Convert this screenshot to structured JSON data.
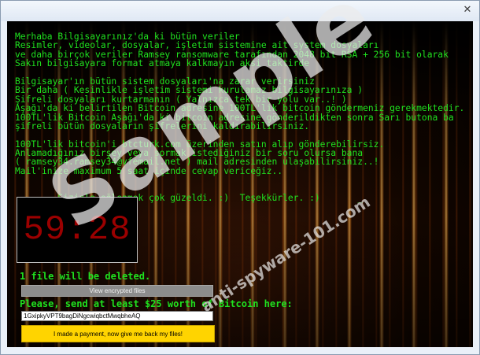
{
  "window": {
    "close_glyph": "✕"
  },
  "message_lines": [
    "Merhaba Bilgisayarınız'da ki bütün veriler",
    "Resimler, videolar, dosyalar, işletim sistemine ait system dosyaları",
    "ve daha birçok veriler Ramsey ransomware tarafından 2048 bit RSA + 256 bit olarak",
    "Sakın bilgisayara format atmaya kalkmayın aksi taktirde",
    "",
    "Bilgisayar'ın bütün sistem dosyaları'na zarar verirsiniz",
    "Bir daha ( Kesinlikle işletim sistemi kurulamaz bilgisayarınıza )",
    "Şifreli dosyaları kurtarmanın ( Yalnızca tek bir yolu var..! )",
    "Aşağı'da ki belirtilen Bitcoin adresine 100TL'lik bitcoin göndermeniz gerekmektedir.",
    "100TL'lik Bitcoin Aşağı'da ki bitcoin adresine gönderildikten sonra Sarı butona ba",
    "şifreli bütün dosyaların şifrelerini kaldırabilirsiniz.",
    "",
    "100TL'lik bitcoin'i btcturk.com üzerinden satın alıp gönderebilirsiz.",
    "Anlamadığınız birşey veya sormak istediğiniz bir soru olursa bana",
    "( ramsey34.ramsey34@vfemail.net ) mail adresinden ulaşabilirsiniz..!",
    "Mail'inize maximum 5 saat içinde cevap vericeğiz..",
    "",
    "",
    "        Sizinle eğlenmek çok güzeldi. :)  Teşekkürler. :)       _"
  ],
  "timer": "59:28",
  "files_deleted_text": "1 file will be deleted.",
  "view_button_label": "View encrypted files",
  "send_text": "Please, send at least $25 worth of Bitcoin here:",
  "wallet_address": "1GxipkyVPT9bagDiNgcwiqbctMwqbheAQ",
  "pay_button_label": "I made a payment, now give me back my files!",
  "watermark": {
    "main": "Sample",
    "site": "anti-spyware-101.com"
  }
}
